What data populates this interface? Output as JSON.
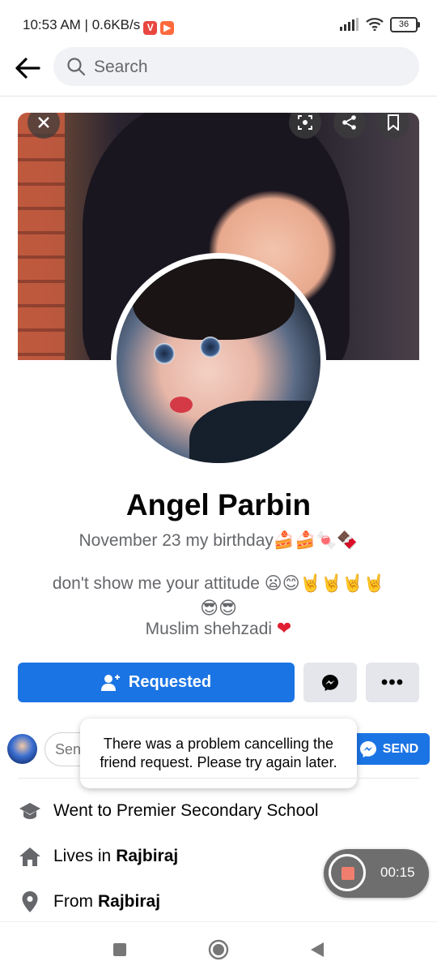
{
  "status_bar": {
    "time": "10:53 AM | 0.6KB/s",
    "battery": "36"
  },
  "search": {
    "placeholder": "Search"
  },
  "profile": {
    "name": "Angel Parbin",
    "bio_line1": "November 23 my birthday🍰🍰🍬🍫",
    "bio_line2": "don't show me your attitude 😦😊🤘🤘🤘🤘",
    "bio_line3": "😎😎",
    "bio_line4": "Muslim shehzadi",
    "bio_heart": "❤"
  },
  "actions": {
    "requested_label": "Requested",
    "more_label": "•••"
  },
  "message": {
    "placeholder": "Send message…",
    "send_label": "SEND"
  },
  "toast": {
    "text": "There was a problem cancelling the friend request. Please try again later."
  },
  "details": {
    "school": "Went to Premier Secondary School",
    "lives_prefix": "Lives in",
    "lives_place": "Rajbiraj",
    "from_prefix": "From",
    "from_place": "Rajbiraj"
  },
  "recorder": {
    "time": "00:15"
  },
  "icons": {
    "back": "arrow-left-icon",
    "search": "search-icon",
    "close": "close-icon",
    "share": "share-icon",
    "save": "bookmark-icon",
    "add_friend": "person-add-icon",
    "messenger": "messenger-icon",
    "school": "graduation-cap-icon",
    "home": "home-icon",
    "location": "location-pin-icon"
  },
  "colors": {
    "primary": "#1b74e4",
    "secondary_btn": "#e4e6eb",
    "muted_text": "#65676b"
  }
}
